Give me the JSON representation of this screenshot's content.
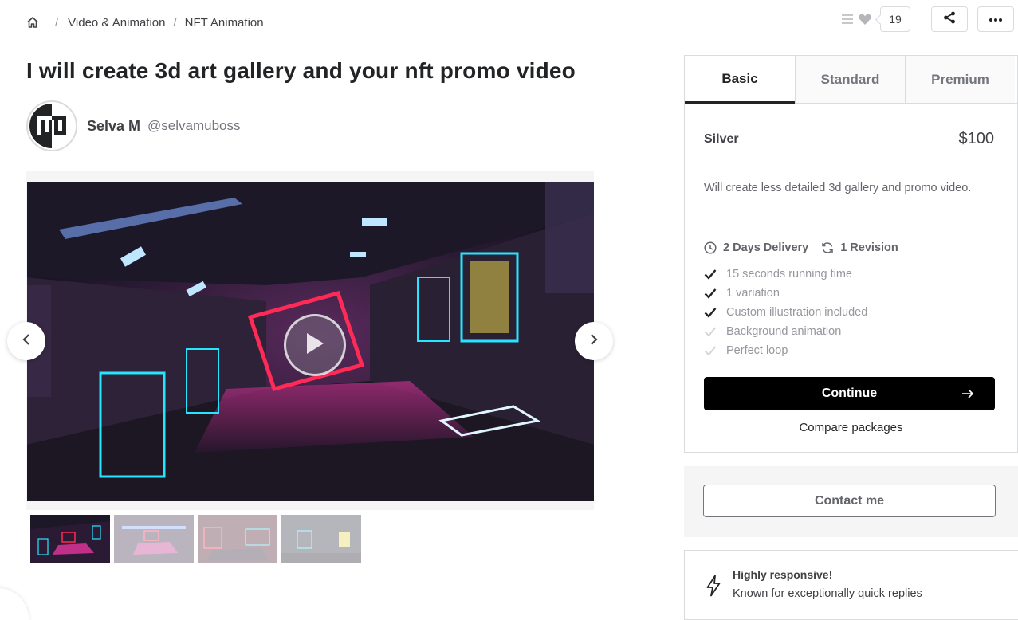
{
  "breadcrumb": {
    "home_icon": "home-icon",
    "items": [
      "Video & Animation",
      "NFT Animation"
    ],
    "separator": "/"
  },
  "actions": {
    "collections_icon": "list-icon",
    "favorite_icon": "heart-icon",
    "favorite_count": "19",
    "share_icon": "share-icon",
    "more_icon": "more-dots-icon"
  },
  "gig": {
    "title": "I will create 3d art gallery and your nft promo video"
  },
  "seller": {
    "name": "Selva M",
    "handle": "@selvamuboss",
    "avatar_monogram": "M"
  },
  "gallery": {
    "play_icon": "play-icon",
    "prev_icon": "chevron-left-icon",
    "next_icon": "chevron-right-icon",
    "thumbnail_count": 4
  },
  "package": {
    "tabs": [
      "Basic",
      "Standard",
      "Premium"
    ],
    "active_tab": "Basic",
    "name": "Silver",
    "price": "$100",
    "description": "Will create less detailed 3d gallery and promo video.",
    "delivery": "2 Days Delivery",
    "revisions": "1 Revision",
    "features": [
      {
        "label": "15 seconds running time",
        "included": true
      },
      {
        "label": "1 variation",
        "included": true
      },
      {
        "label": "Custom illustration included",
        "included": true
      },
      {
        "label": "Background animation",
        "included": false
      },
      {
        "label": "Perfect loop",
        "included": false
      }
    ],
    "continue_label": "Continue",
    "compare_label": "Compare packages"
  },
  "contact": {
    "label": "Contact me"
  },
  "highlight": {
    "icon": "lightning-icon",
    "title": "Highly responsive!",
    "subtitle": "Known for exceptionally quick replies"
  },
  "colors": {
    "text_dark": "#222325",
    "text_body": "#404145",
    "text_muted": "#95979d",
    "border": "#dadbdd",
    "button_black": "#000000"
  }
}
